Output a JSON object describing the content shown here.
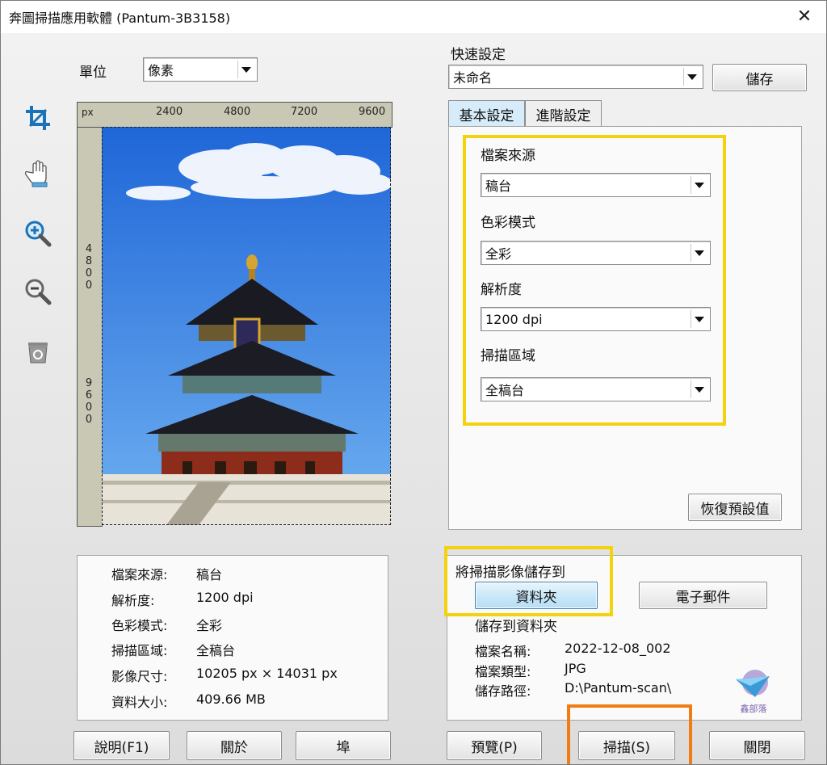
{
  "window": {
    "title": "奔圖掃描應用軟體 (Pantum-3B3158)",
    "close_glyph": "✕"
  },
  "unit": {
    "label": "單位",
    "value": "像素"
  },
  "quick": {
    "label": "快速設定",
    "value": "未命名",
    "save_label": "儲存"
  },
  "ruler": {
    "unit": "px",
    "top_ticks": [
      "2400",
      "4800",
      "7200",
      "9600"
    ],
    "left_ticks": [
      "4800",
      "9600"
    ]
  },
  "tools": [
    "crop-icon",
    "hand-icon",
    "zoom-in-icon",
    "zoom-out-icon",
    "recycle-bin-icon"
  ],
  "tabs": {
    "basic": "基本設定",
    "advanced": "進階設定"
  },
  "settings": {
    "source_label": "檔案來源",
    "source_value": "稿台",
    "color_label": "色彩模式",
    "color_value": "全彩",
    "resolution_label": "解析度",
    "resolution_value": "1200 dpi",
    "area_label": "掃描區域",
    "area_value": "全稿台",
    "restore_label": "恢復預設值"
  },
  "summary": [
    {
      "label": "檔案來源:",
      "value": "稿台"
    },
    {
      "label": "解析度:",
      "value": "1200 dpi"
    },
    {
      "label": "色彩模式:",
      "value": "全彩"
    },
    {
      "label": "掃描區域:",
      "value": "全稿台"
    },
    {
      "label": "影像尺寸:",
      "value": "10205 px × 14031 px"
    },
    {
      "label": "資料大小:",
      "value": "409.66 MB"
    }
  ],
  "saveto": {
    "label": "將掃描影像儲存到",
    "folder_button": "資料夾",
    "email_button": "電子郵件",
    "subtitle": "儲存到資料夾",
    "filename_label": "檔案名稱:",
    "filename_value": "2022-12-08_002",
    "filetype_label": "檔案類型:",
    "filetype_value": "JPG",
    "path_label": "儲存路徑:",
    "path_value": "D:\\Pantum-scan\\"
  },
  "watermark": {
    "text": "鑫部落"
  },
  "bottom": {
    "help": "說明(F1)",
    "about": "關於",
    "port": "埠",
    "preview": "預覽(P)",
    "scan": "掃描(S)",
    "close": "關閉"
  },
  "colors": {
    "highlight_yellow": "#f5d20e",
    "highlight_orange": "#f07c16",
    "tool_blue": "#1a73b8"
  }
}
